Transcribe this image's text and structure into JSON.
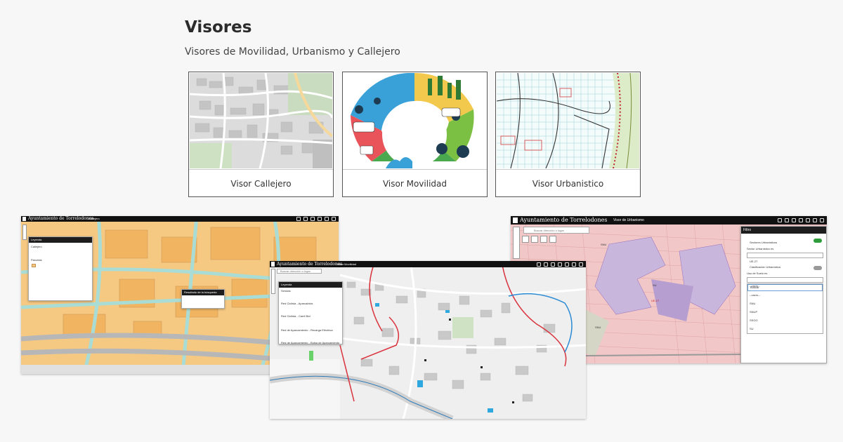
{
  "header": {
    "title": "Visores",
    "subtitle": "Visores de Movilidad, Urbanismo y Callejero"
  },
  "cards": [
    {
      "label": "Visor Callejero"
    },
    {
      "label": "Visor Movilidad"
    },
    {
      "label": "Visor Urbanistico"
    }
  ],
  "callejero_shot": {
    "brand": "Ayuntamiento de Torrelodones",
    "subtitle": "Callejero",
    "legend_title": "Leyenda",
    "legend_item": "Callejero",
    "legend_parcelas": "Parcelas",
    "popup_title": "Resultado de la búsqueda"
  },
  "movilidad_shot": {
    "brand": "Ayuntamiento de Torrelodones",
    "subtitle": "Visor Movilidad",
    "search_placeholder": "Buscar dirección o lugar",
    "legend_title": "Leyenda",
    "legend_items": [
      "Sendas",
      "Red Ciclista - Aparcabicis",
      "Red Ciclista - Carril Bici",
      "Red de Aparcamiento - Recarga Eléctrica",
      "Red de Aparcamiento - Bolsa de Aparcamiento"
    ]
  },
  "urbanismo_shot": {
    "brand": "Ayuntamiento de Torrelodones",
    "subtitle": "Visor de Urbanismo",
    "search_placeholder": "Buscar dirección o lugar",
    "filter_title": "Filtro",
    "filter_sectors": "Sectores Urbanísticos",
    "sector_label": "Sector Urbanístico es",
    "sector_value": "UE-27",
    "classification": "Clasificación Urbanística",
    "suelo_label": "Uso de Suelo es",
    "suelo_value": "--vacío--",
    "options": [
      "Buscar",
      "--vacío--",
      "SNU",
      "SNUP",
      "SSGG",
      "SU"
    ],
    "map_labels": [
      "SNU",
      "SU",
      "UE-27",
      "SNU"
    ]
  },
  "colors": {
    "dark": "#111111",
    "accent_green": "#2e9c3a",
    "road_red": "#d9323c",
    "parcel_orange": "#f6c982",
    "urban_pink": "#f1c7c7",
    "urban_purple": "#c9b6dd"
  }
}
